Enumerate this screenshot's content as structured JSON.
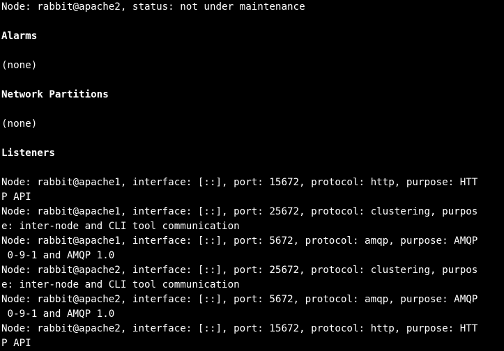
{
  "terminal": {
    "background": "#000000",
    "foreground": "#ffffff",
    "lines": [
      {
        "text": "Node: rabbit@apache2, status: not under maintenance",
        "bold": false
      },
      {
        "text": "",
        "bold": false
      },
      {
        "text": "Alarms",
        "bold": true
      },
      {
        "text": "",
        "bold": false
      },
      {
        "text": "(none)",
        "bold": false
      },
      {
        "text": "",
        "bold": false
      },
      {
        "text": "Network Partitions",
        "bold": true
      },
      {
        "text": "",
        "bold": false
      },
      {
        "text": "(none)",
        "bold": false
      },
      {
        "text": "",
        "bold": false
      },
      {
        "text": "Listeners",
        "bold": true
      },
      {
        "text": "",
        "bold": false
      },
      {
        "text": "Node: rabbit@apache1, interface: [::], port: 15672, protocol: http, purpose: HTT",
        "bold": false
      },
      {
        "text": "P API",
        "bold": false
      },
      {
        "text": "Node: rabbit@apache1, interface: [::], port: 25672, protocol: clustering, purpos",
        "bold": false
      },
      {
        "text": "e: inter-node and CLI tool communication",
        "bold": false
      },
      {
        "text": "Node: rabbit@apache1, interface: [::], port: 5672, protocol: amqp, purpose: AMQP",
        "bold": false
      },
      {
        "text": " 0-9-1 and AMQP 1.0",
        "bold": false
      },
      {
        "text": "Node: rabbit@apache2, interface: [::], port: 25672, protocol: clustering, purpos",
        "bold": false
      },
      {
        "text": "e: inter-node and CLI tool communication",
        "bold": false
      },
      {
        "text": "Node: rabbit@apache2, interface: [::], port: 5672, protocol: amqp, purpose: AMQP",
        "bold": false
      },
      {
        "text": " 0-9-1 and AMQP 1.0",
        "bold": false
      },
      {
        "text": "Node: rabbit@apache2, interface: [::], port: 15672, protocol: http, purpose: HTT",
        "bold": false
      },
      {
        "text": "P API",
        "bold": false
      }
    ]
  }
}
